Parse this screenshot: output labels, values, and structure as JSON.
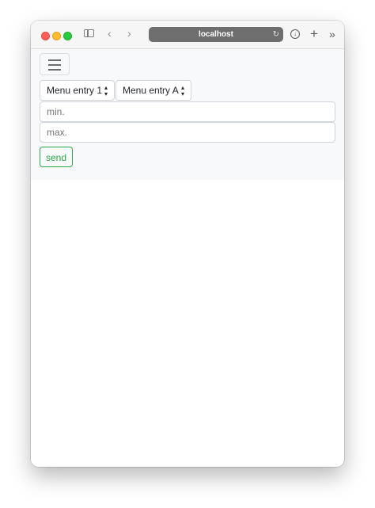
{
  "browser": {
    "url": "localhost",
    "icons": {
      "sidebar": "sidebar-icon",
      "back": "chevron-left-icon",
      "forward": "chevron-right-icon",
      "reload": "reload-icon",
      "download": "download-icon",
      "new_tab": "plus-icon",
      "more": "double-chevron-right-icon"
    },
    "traffic_colors": {
      "close": "#ff5f57",
      "minimize": "#febc2e",
      "maximize": "#28c840"
    }
  },
  "navbar": {
    "toggler_icon": "hamburger-icon",
    "select_1": {
      "value": "Menu entry 1"
    },
    "select_2": {
      "value": "Menu entry A"
    },
    "min_input": {
      "placeholder": "min."
    },
    "max_input": {
      "placeholder": "max."
    },
    "send_label": "send",
    "send_color": "#28a745"
  }
}
